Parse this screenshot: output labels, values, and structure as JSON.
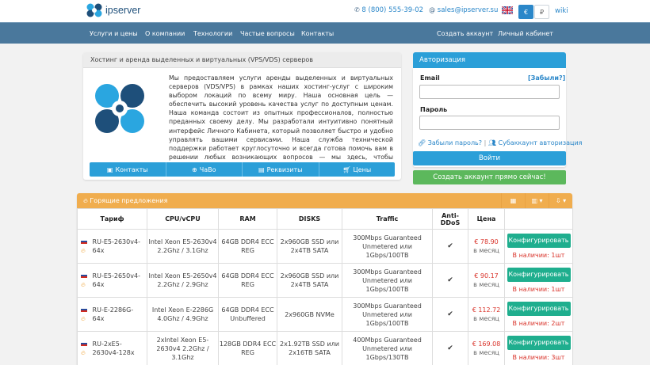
{
  "header": {
    "logo_text": "ipserver",
    "phone": "8 (800) 555-39-02",
    "email": "sales@ipserver.su",
    "currency_eur": "€",
    "currency_rub": "₽",
    "wiki": "wiki"
  },
  "nav": {
    "items": [
      "Услуги и цены",
      "О компании",
      "Технологии",
      "Частые вопросы",
      "Контакты"
    ],
    "right": [
      "Создать аккаунт",
      "Личный кабинет"
    ]
  },
  "about": {
    "title": "Хостинг и аренда выделенных и виртуальных (VPS/VDS) серверов",
    "text": "Мы предоставляем услуги аренды выделенных и виртуальных серверов (VDS/VPS) в рамках наших хостинг-услуг с широким выбором локаций по всему миру. Наша основная цель — обеспечить высокий уровень качества услуг по доступным ценам. Наша команда состоит из опытных профессионалов, полностью преданных своему делу. Мы разработали интуитивно понятный интерфейс Личного Кабинета, который позволяет быстро и удобно управлять вашими сервисами. Наша служба технической поддержки работает круглосуточно и всегда готова помочь вам в решении любых возникающих вопросов — мы здесь, чтобы поддержать вас в любой ситуации.",
    "tabs": [
      "Контакты",
      "ЧаВо",
      "Реквизиты",
      "Цены"
    ]
  },
  "auth": {
    "title": "Авторизация",
    "email_label": "Email",
    "forgot_label": "[Забыли?]",
    "password_label": "Пароль",
    "forgot_password": "Забыли пароль?",
    "separator": "|",
    "subaccount": "Субаккаунт авторизация",
    "login_button": "Войти",
    "create_button": "Создать аккаунт прямо сейчас!"
  },
  "offers": {
    "title": "Горящие предложения",
    "columns": [
      "Тариф",
      "CPU/vCPU",
      "RAM",
      "DISKS",
      "Traffic",
      "Anti-DDoS",
      "Цена",
      ""
    ],
    "configure_label": "Конфигурировать",
    "per_month": "в месяц",
    "rows": [
      {
        "tariff": "RU-E5-2630v4-64x",
        "cpu": "Intel Xeon E5-2630v4 2.2Ghz / 3.1Ghz",
        "ram": "64GB DDR4 ECC REG",
        "disks": "2x960GB SSD или 2x4TB SATA",
        "traffic": "300Mbps Guaranteed Unmetered или 1Gbps/100TB",
        "price": "€ 78.90",
        "avail": "В наличии: 1шт"
      },
      {
        "tariff": "RU-E5-2650v4-64x",
        "cpu": "Intel Xeon E5-2650v4 2.2Ghz / 2.9Ghz",
        "ram": "64GB DDR4 ECC REG",
        "disks": "2x960GB SSD или 2x4TB SATA",
        "traffic": "300Mbps Guaranteed Unmetered или 1Gbps/100TB",
        "price": "€ 90.17",
        "avail": "В наличии: 1шт"
      },
      {
        "tariff": "RU-E-2286G-64x",
        "cpu": "Intel Xeon E-2286G 4.0Ghz / 4.9Ghz",
        "ram": "64GB DDR4 ECC Unbuffered",
        "disks": "2x960GB NVMe",
        "traffic": "300Mbps Guaranteed Unmetered или 1Gbps/100TB",
        "price": "€ 112.72",
        "avail": "В наличии: 2шт"
      },
      {
        "tariff": "RU-2xE5-2630v4-128x",
        "cpu": "2xIntel Xeon E5-2630v4 2.2Ghz / 3.1Ghz",
        "ram": "128GB DDR4 ECC REG",
        "disks": "2x1.92TB SSD или 2x16TB SATA",
        "traffic": "400Mbps Guaranteed Unmetered или 1Gbps/130TB",
        "price": "€ 169.08",
        "avail": "В наличии: 3шт"
      }
    ]
  }
}
